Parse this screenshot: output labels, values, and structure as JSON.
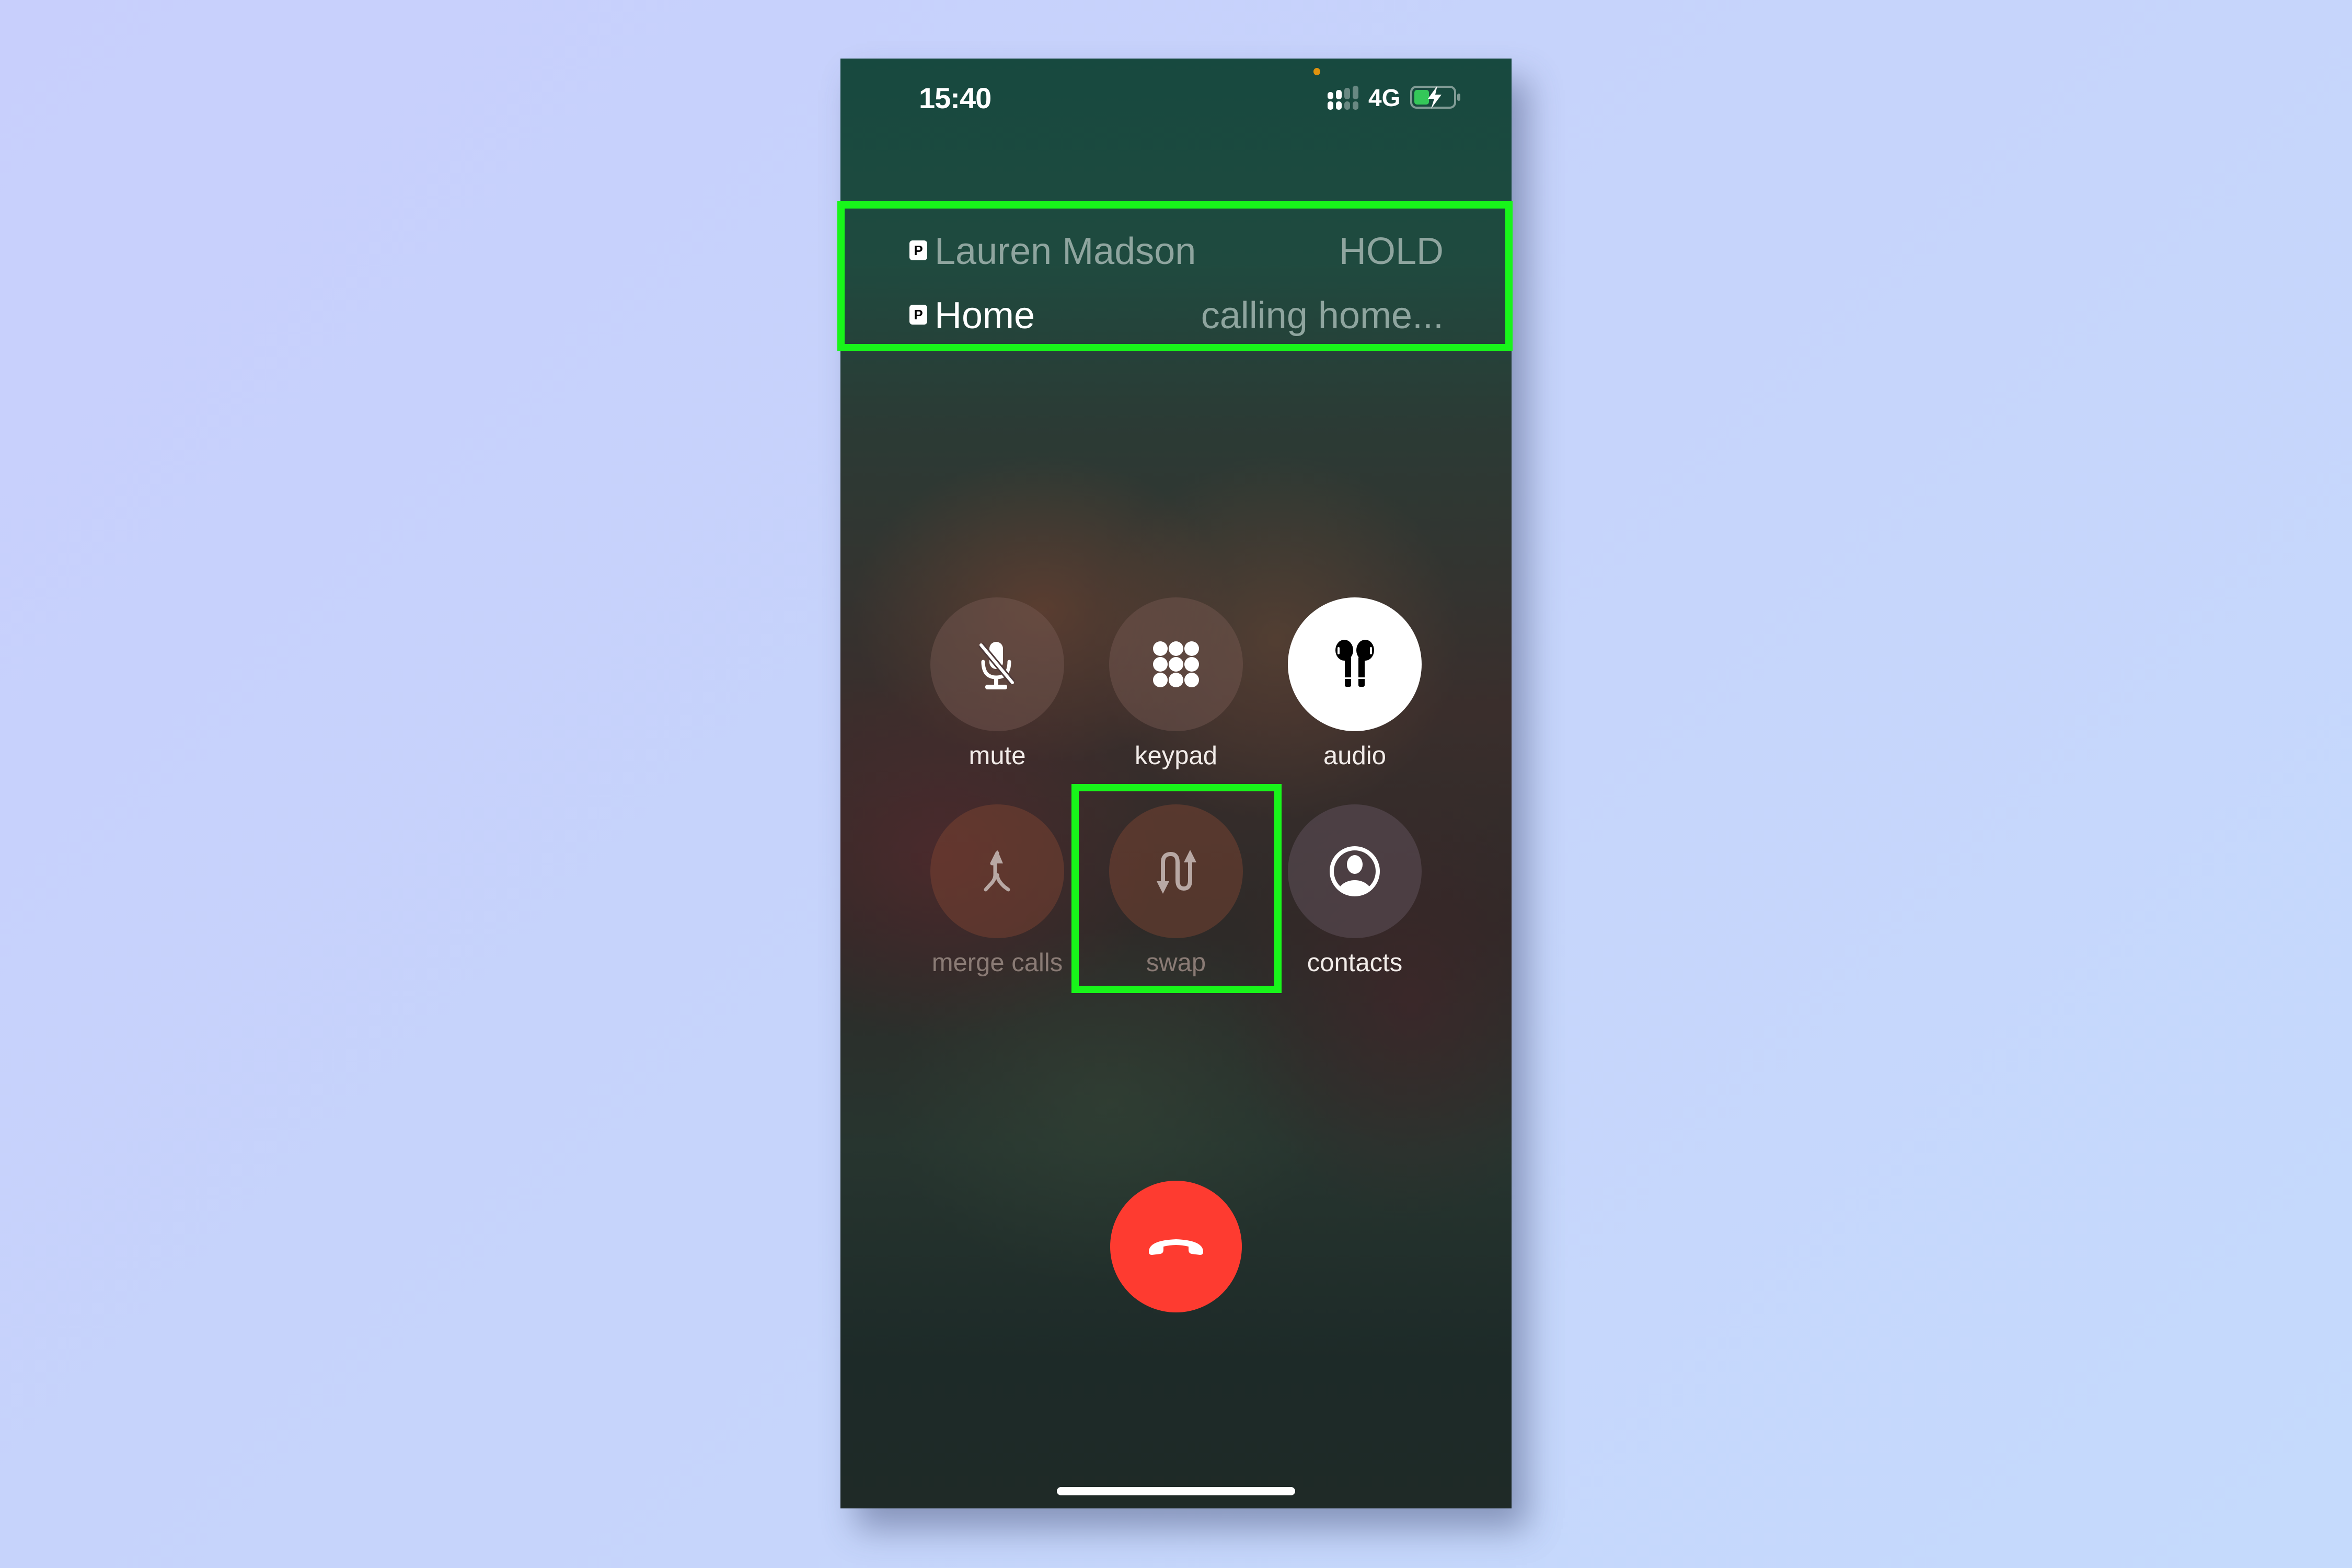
{
  "status_bar": {
    "time": "15:40",
    "network": "4G",
    "icons": [
      "privacy-dot-indicator",
      "cellular-signal-icon",
      "battery-charging-icon"
    ]
  },
  "calls": [
    {
      "badge": "P",
      "name": "Lauren Madson",
      "status": "HOLD"
    },
    {
      "badge": "P",
      "name": "Home",
      "status": "calling home..."
    }
  ],
  "controls": [
    {
      "id": "mute",
      "label": "mute",
      "icon": "mic-slash-icon",
      "enabled": true
    },
    {
      "id": "keypad",
      "label": "keypad",
      "icon": "keypad-grid-icon",
      "enabled": true
    },
    {
      "id": "audio",
      "label": "audio",
      "icon": "airpods-icon",
      "enabled": true,
      "active": true
    },
    {
      "id": "merge-calls",
      "label": "merge calls",
      "icon": "merge-arrow-icon",
      "enabled": false
    },
    {
      "id": "swap",
      "label": "swap",
      "icon": "swap-arrows-icon",
      "enabled": false
    },
    {
      "id": "contacts",
      "label": "contacts",
      "icon": "person-circle-icon",
      "enabled": true
    }
  ],
  "end_call": {
    "icon": "phone-hangup-icon"
  },
  "colors": {
    "highlight": "#18f51a",
    "end_call": "#fe3b30",
    "privacy_dot": "#e0920e",
    "battery_fill": "#34c759",
    "background": "#c6d4fb"
  }
}
